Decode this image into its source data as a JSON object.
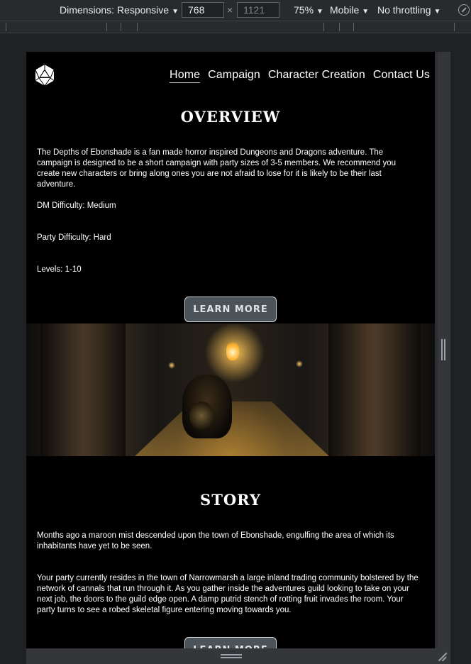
{
  "devtools": {
    "dimensions_label": "Dimensions: Responsive",
    "width_value": "768",
    "times": "×",
    "height_value": "1121",
    "zoom": "75%",
    "device_type": "Mobile",
    "throttling": "No throttling",
    "caret": "▼"
  },
  "site": {
    "nav": [
      "Home",
      "Campaign",
      "Character Creation",
      "Contact Us"
    ],
    "overview": {
      "title": "OVERVIEW",
      "intro": "The Depths of Ebonshade is a fan made horror inspired Dungeons and Dragons adventure. The campaign is designed to be a short campaign with party sizes of 3-5 members. We recommend you create new characters or bring along ones you are not afraid to lose for it is likely to be their last adventure.",
      "dm_difficulty": "DM Difficulty: Medium",
      "party_difficulty": "Party Difficulty: Hard",
      "levels": "Levels: 1-10",
      "button": "LEARN MORE"
    },
    "story": {
      "title": "STORY",
      "p1": "Months ago a maroon mist descended upon the town of Ebonshade, engulfing the area of which its inhabitants have yet to be seen.",
      "p2": "Your party currently resides in the town of Narrowmarsh a large inland trading community bolstered by the network of cannals that run through it. As you gather inside the adventures guild looking to take on your next job, the doors to the guild edge open. A damp putrid stench of rotting fruit invades the room. Your party turns to see a robed skeletal figure entering moving towards you.",
      "button": "LEARN MORE"
    }
  }
}
